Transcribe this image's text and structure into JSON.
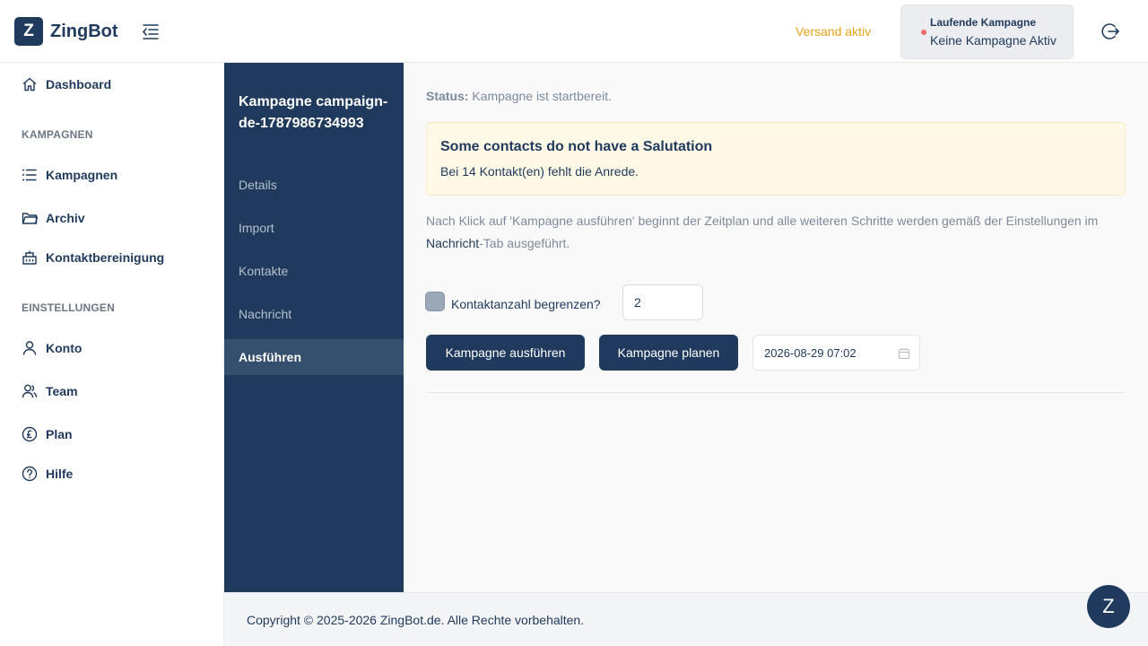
{
  "app": {
    "logo_letter": "Z",
    "name": "ZingBot"
  },
  "header": {
    "send_status": "Versand aktiv",
    "running_campaign": {
      "title": "Laufende Kampagne",
      "value": "Keine Kampagne Aktiv"
    }
  },
  "sidebar": {
    "dashboard": "Dashboard",
    "section_campaigns": "KAMPAGNEN",
    "campaigns": "Kampagnen",
    "archive": "Archiv",
    "contact_cleanup": "Kontaktbereinigung",
    "section_settings": "EINSTELLUNGEN",
    "account": "Konto",
    "team": "Team",
    "plan": "Plan",
    "help": "Hilfe"
  },
  "subnav": {
    "title": "Kampagne campaign-de-1787986734993",
    "items": [
      "Details",
      "Import",
      "Kontakte",
      "Nachricht",
      "Ausführen"
    ],
    "active": "Ausführen"
  },
  "main": {
    "status_label": "Status:",
    "status_value": "Kampagne ist startbereit.",
    "alert": {
      "title": "Some contacts do not have a Salutation",
      "text": "Bei 14 Kontakt(en) fehlt die Anrede."
    },
    "info_before": "Nach Klick auf 'Kampagne ausführen' beginnt der Zeitplan und alle weiteren Schritte werden gemäß der Einstellungen im ",
    "info_link": "Nachricht",
    "info_after": "-Tab ausgeführt.",
    "limit_label": "Kontaktanzahl begrenzen?",
    "limit_checked": false,
    "limit_value": "2",
    "run_button": "Kampagne ausführen",
    "plan_button": "Kampagne planen",
    "schedule_datetime": "2026-08-29 07:02"
  },
  "footer": {
    "copyright": "Copyright © 2025-2026 ZingBot.de. Alle Rechte vorbehalten."
  },
  "chat": {
    "label": "Z"
  },
  "colors": {
    "primary": "#1f3a5c",
    "warning_text": "#e8a317",
    "alert_bg": "#fef9e6",
    "status_dot": "#f06a6a"
  }
}
